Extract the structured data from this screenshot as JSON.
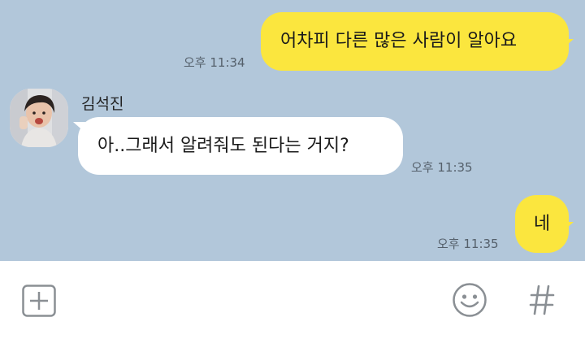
{
  "chat": {
    "background_color": "#b2c7da",
    "my_bubble_color": "#fbe63e",
    "their_bubble_color": "#ffffff",
    "messages": [
      {
        "from": "me",
        "text": "어차피 다른 많은 사람이 알아요",
        "time": "오후 11:34"
      },
      {
        "from": "them",
        "sender": "김석진",
        "text": "아..그래서 알려줘도 된다는 거지?",
        "time": "오후 11:35"
      },
      {
        "from": "me",
        "text": "네",
        "time": "오후 11:35"
      }
    ]
  },
  "input_bar": {
    "icons": [
      "add-icon",
      "emoji-icon",
      "hash-icon"
    ]
  }
}
